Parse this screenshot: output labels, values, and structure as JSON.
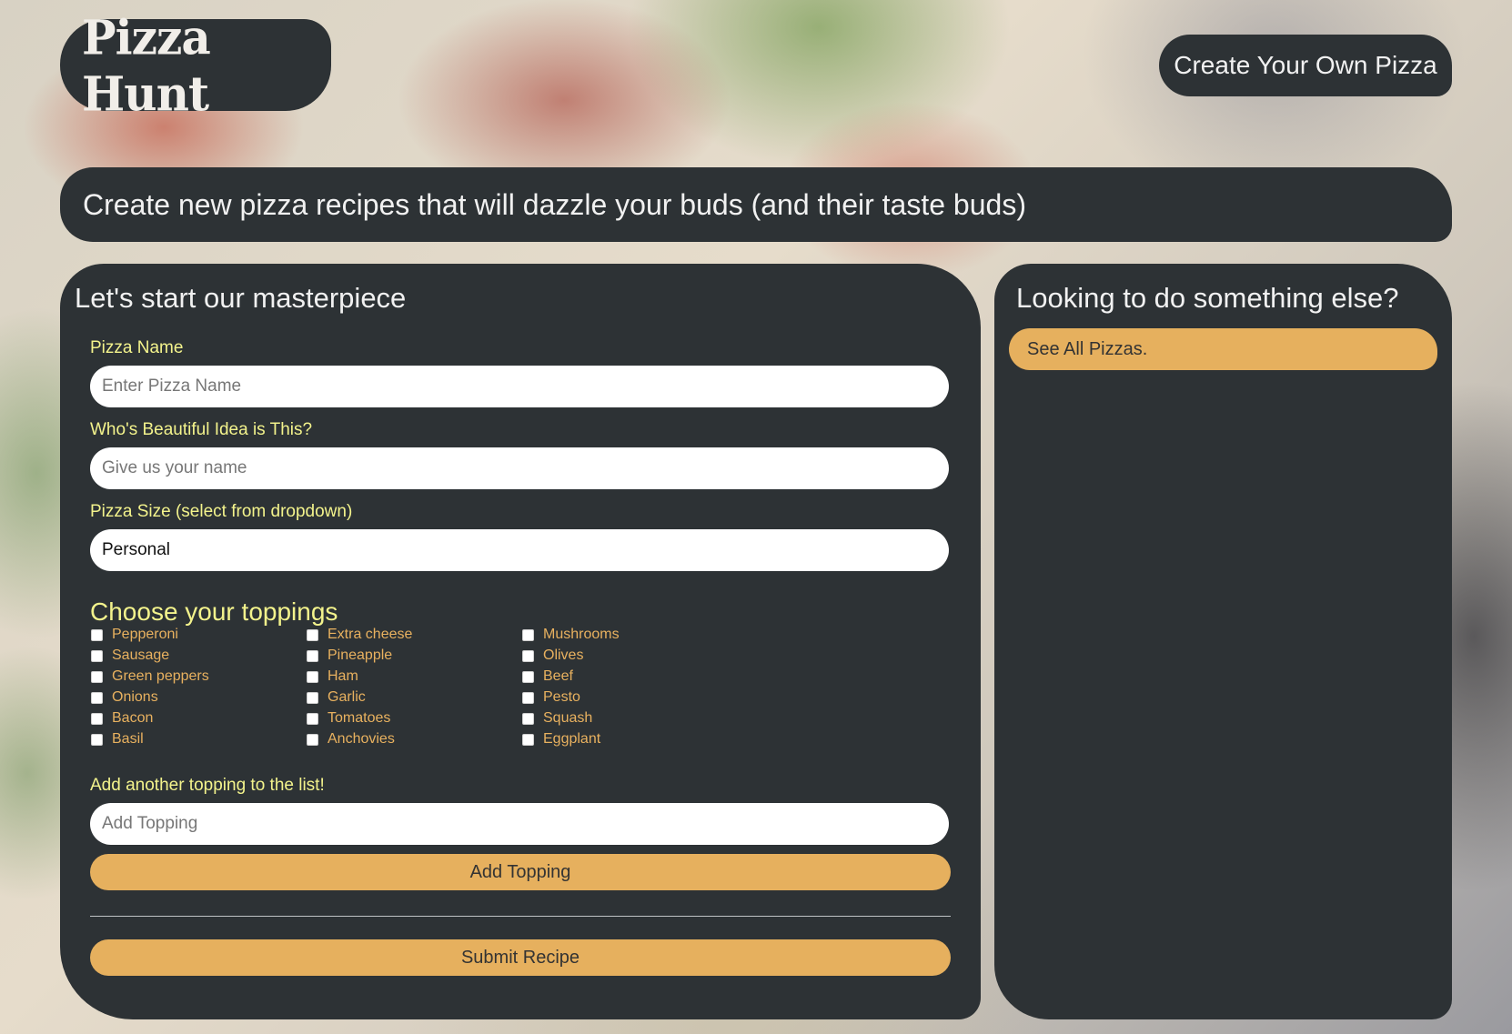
{
  "header": {
    "logo_text": "Pizza Hunt",
    "create_button_label": "Create Your Own Pizza"
  },
  "banner": {
    "text": "Create new pizza recipes that will dazzle your buds (and their taste buds)"
  },
  "form": {
    "title": "Let's start our masterpiece",
    "pizza_name": {
      "label": "Pizza Name",
      "placeholder": "Enter Pizza Name"
    },
    "author": {
      "label": "Who's Beautiful Idea is This?",
      "placeholder": "Give us your name"
    },
    "size": {
      "label": "Pizza Size (select from dropdown)",
      "selected": "Personal"
    },
    "toppings_title": "Choose your toppings",
    "toppings": [
      "Pepperoni",
      "Sausage",
      "Green peppers",
      "Onions",
      "Bacon",
      "Basil",
      "Extra cheese",
      "Pineapple",
      "Ham",
      "Garlic",
      "Tomatoes",
      "Anchovies",
      "Mushrooms",
      "Olives",
      "Beef",
      "Pesto",
      "Squash",
      "Eggplant"
    ],
    "add_topping": {
      "label": "Add another topping to the list!",
      "placeholder": "Add Topping",
      "button_label": "Add Topping"
    },
    "submit_label": "Submit Recipe"
  },
  "sidebar": {
    "title": "Looking to do something else?",
    "link_label": "See All Pizzas."
  }
}
